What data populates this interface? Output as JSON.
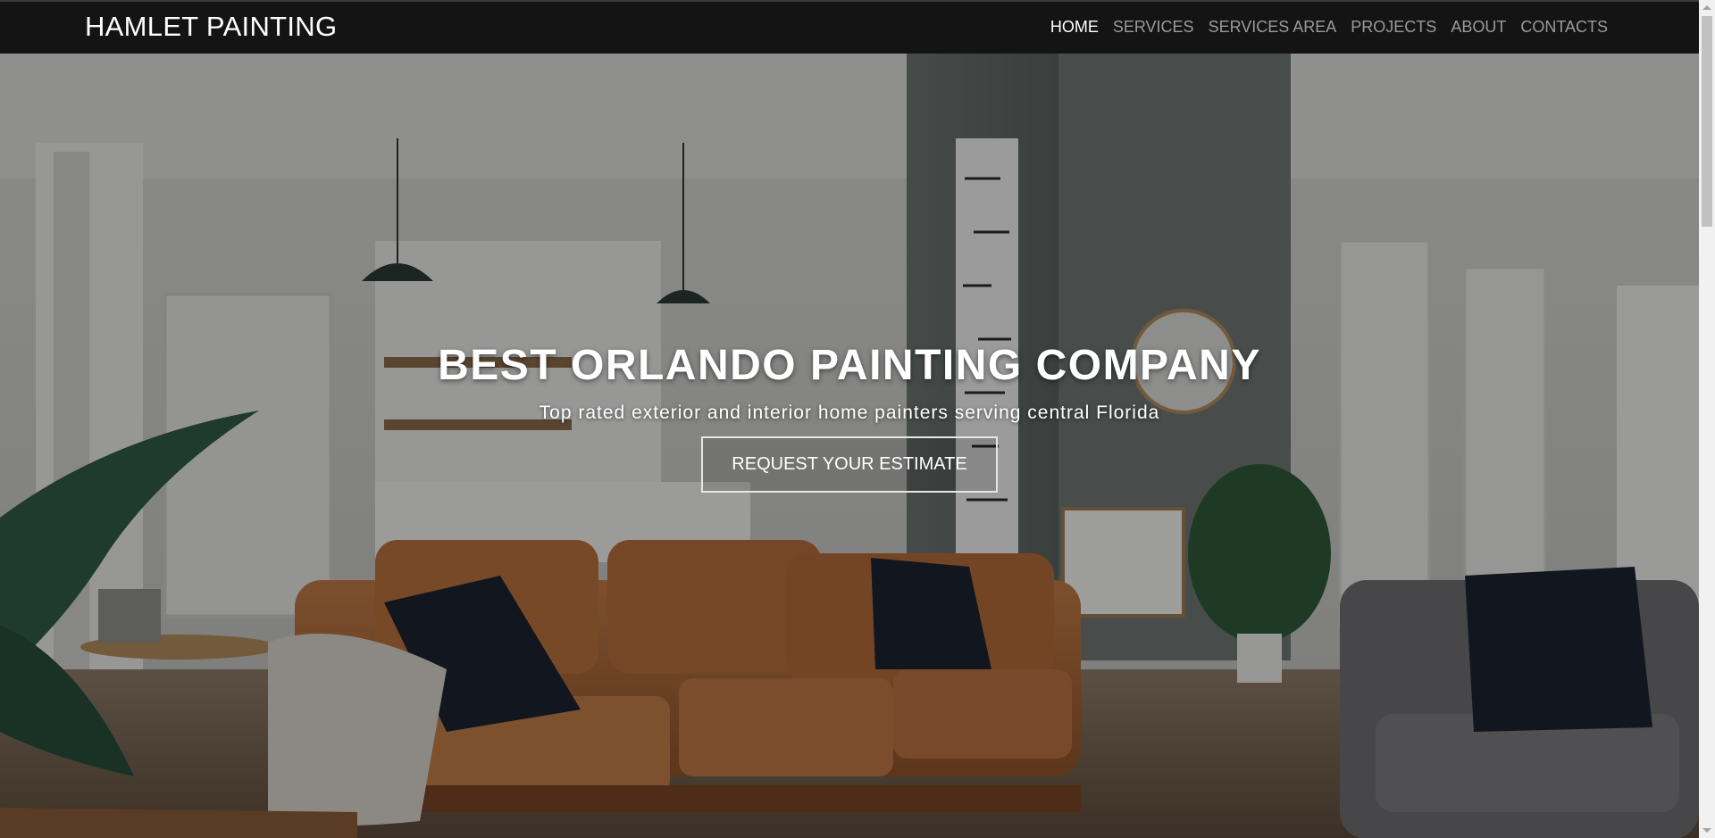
{
  "brand": {
    "name": "HAMLET PAINTING"
  },
  "nav": {
    "items": [
      {
        "label": "HOME",
        "active": true
      },
      {
        "label": "SERVICES",
        "active": false
      },
      {
        "label": "SERVICES AREA",
        "active": false
      },
      {
        "label": "PROJECTS",
        "active": false
      },
      {
        "label": "ABOUT",
        "active": false
      },
      {
        "label": "CONTACTS",
        "active": false
      }
    ]
  },
  "hero": {
    "title": "BEST ORLANDO PAINTING COMPANY",
    "subtitle": "Top rated exterior and interior home painters serving central Florida",
    "cta_label": "REQUEST YOUR ESTIMATE",
    "background": "living-room-photo"
  },
  "colors": {
    "navbar_bg": "#141414",
    "nav_link": "#9a9a9a",
    "nav_link_active": "#ffffff",
    "hero_text": "#ffffff",
    "sofa": "#b5703f"
  }
}
